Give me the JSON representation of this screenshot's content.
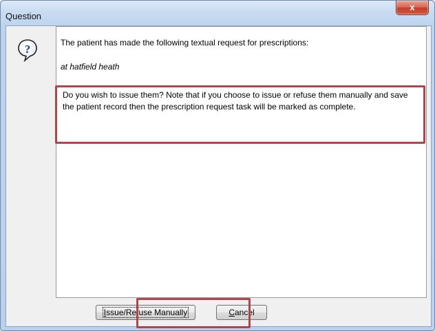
{
  "window": {
    "title": "Question",
    "close_glyph": "x"
  },
  "icon": {
    "name": "question-icon",
    "glyph": "?"
  },
  "message": {
    "line1": "The patient has made the following textual request for prescriptions:",
    "request_text": "at hatfield heath",
    "question": "Do you wish to issue them? Note that if you choose to issue or refuse them manually and save the patient record then the prescription request task will be marked as complete."
  },
  "buttons": {
    "issue_accel": "I",
    "issue_rest": "ssue/Refuse Manually",
    "cancel_accel": "C",
    "cancel_rest": "ancel"
  },
  "colors": {
    "highlight": "#b0464a",
    "close_button": "#c4402a",
    "title_gradient": "#c9dcf1"
  }
}
